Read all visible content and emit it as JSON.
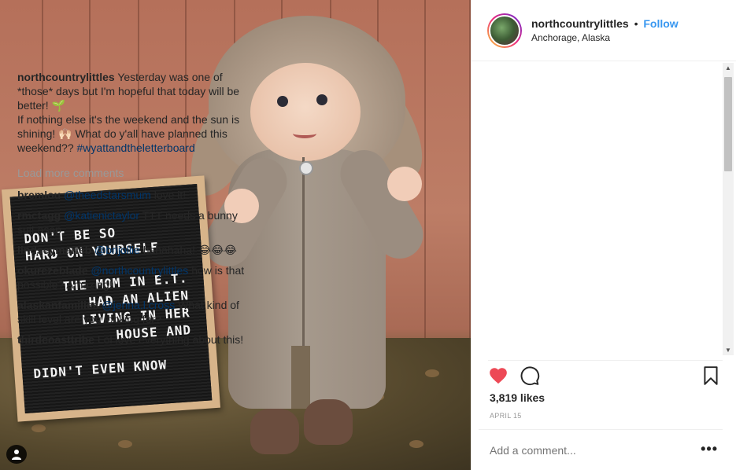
{
  "photo": {
    "letterboard": [
      "DON'T BE SO",
      "HARD ON YOURSELF",
      "THE MOM IN E.T.",
      "HAD AN ALIEN",
      "LIVING IN HER",
      "HOUSE AND",
      "DIDN'T EVEN KNOW"
    ],
    "tag_icon": "user-icon"
  },
  "header": {
    "username": "northcountrylittles",
    "separator": "•",
    "follow_label": "Follow",
    "location": "Anchorage, Alaska"
  },
  "caption": {
    "username": "northcountrylittles",
    "text1": "Yesterday was one of *those* days but I'm hopeful that today will be better! 🌱",
    "text2": "If nothing else it's the weekend and the sun is shining! 🙌🏻 What do y'all have planned this weekend??",
    "hashtag": "#wyattandtheletterboard"
  },
  "load_more": "Load more comments",
  "comments": [
    {
      "user": "bremlou",
      "mention": "@theedstarsmum",
      "text": " love it!"
    },
    {
      "user": "rmctagg",
      "mention": "@katienictaylor",
      "text": " TTT needs a bunny suit asap"
    },
    {
      "user": "lindseymarieb",
      "mention": "@brijollie",
      "text": " hahahaha! 😂😂😂"
    },
    {
      "user": "okurczeblade",
      "mention": "@northcountrylittles",
      "text": " how is that possible? Amazing!"
    },
    {
      "user": "alaskanfamilies",
      "mention": "@jenna.l.cross",
      "text": " What kind of skill level are you looking for?"
    },
    {
      "user": "thirdcoasttribe",
      "mention": "",
      "text": "Lol love everything about this!"
    }
  ],
  "actions": {
    "like_icon": "heart-icon",
    "comment_icon": "comment-icon",
    "save_icon": "bookmark-icon",
    "like_color": "#ed4956"
  },
  "likes": "3,819 likes",
  "date": "APRIL 15",
  "add_comment_placeholder": "Add a comment...",
  "more_label": "•••"
}
